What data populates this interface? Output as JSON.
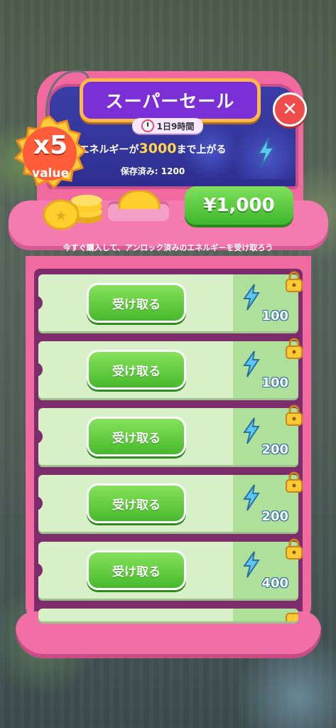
{
  "header": {
    "title": "スーパーセール",
    "timer": "1日9時間",
    "energy_prefix": "エネルギーが",
    "energy_amount": "3000",
    "energy_suffix": "まで上がる",
    "saved": "保存済み: 1200"
  },
  "badge": {
    "multiplier": "x5",
    "label": "value"
  },
  "purchase": {
    "price": "¥1,000"
  },
  "instruction": "今すぐ購入して、アンロック済みのエネルギーを受け取ろう",
  "rewards": [
    {
      "claim_label": "受け取る",
      "amount": "100"
    },
    {
      "claim_label": "受け取る",
      "amount": "100"
    },
    {
      "claim_label": "受け取る",
      "amount": "200"
    },
    {
      "claim_label": "受け取る",
      "amount": "200"
    },
    {
      "claim_label": "受け取る",
      "amount": "400"
    }
  ],
  "colors": {
    "accent": "#7b2fd6",
    "primary_button": "#47b92c",
    "machine": "#f06aa0"
  }
}
